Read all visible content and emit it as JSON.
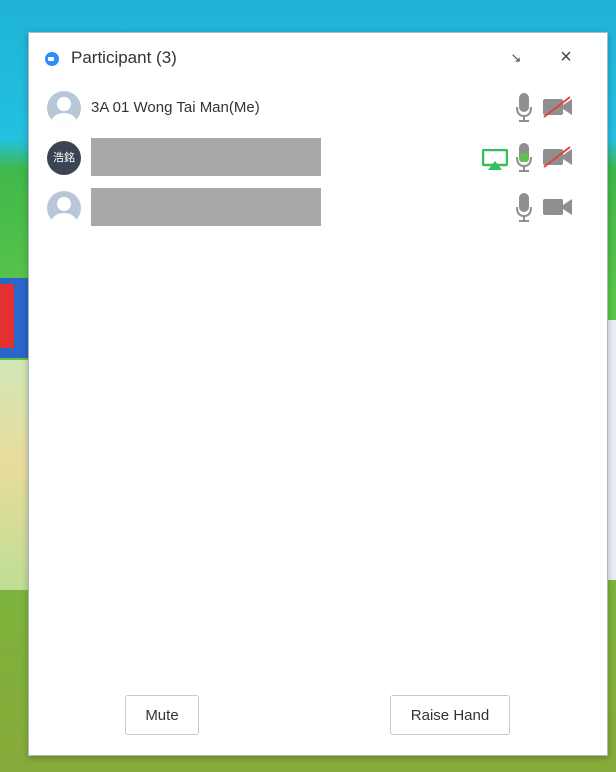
{
  "panel": {
    "title": "Participant (3)",
    "collapse_glyph": "↘",
    "close_glyph": "×"
  },
  "participants": [
    {
      "name": "3A 01 Wong Tai Man(Me)",
      "avatar": "default",
      "sharing": false,
      "mic": "muted-gray",
      "camera": "off"
    },
    {
      "name": "",
      "avatar_text": "浩銘",
      "redacted": true,
      "sharing": true,
      "mic": "active-green",
      "camera": "off"
    },
    {
      "name": "",
      "avatar": "default",
      "redacted": true,
      "sharing": false,
      "mic": "gray",
      "camera": "on-gray"
    }
  ],
  "footer": {
    "mute_label": "Mute",
    "raise_hand_label": "Raise Hand"
  },
  "colors": {
    "accent": "#2d8cff",
    "share_green": "#33c05a",
    "mic_green": "#62c14d",
    "icon_gray": "#8f8f8f",
    "strike_red": "#e8403a"
  },
  "icons": [
    "app-logo-icon",
    "collapse-icon",
    "close-icon",
    "avatar-icon",
    "screen-share-icon",
    "microphone-icon",
    "video-off-icon",
    "video-icon"
  ]
}
